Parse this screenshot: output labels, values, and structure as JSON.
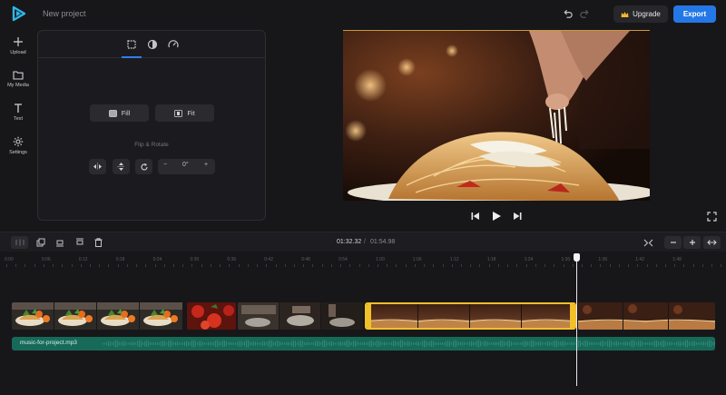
{
  "header": {
    "project_title": "New project",
    "upgrade_label": "Upgrade",
    "export_label": "Export",
    "accent_color": "#2478e6"
  },
  "nav": {
    "items": [
      {
        "label": "Upload",
        "icon": "plus-icon"
      },
      {
        "label": "My Media",
        "icon": "folder-icon"
      },
      {
        "label": "Text",
        "icon": "text-icon"
      },
      {
        "label": "Settings",
        "icon": "gear-icon"
      }
    ]
  },
  "panel": {
    "tabs": [
      "crop-icon",
      "contrast-icon",
      "speed-icon"
    ],
    "fill_label": "Fill",
    "fit_label": "Fit",
    "flip_rotate_label": "Flip & Rotate",
    "rotation_value": "0°",
    "minus_label": "−",
    "plus_label": "+"
  },
  "timeline": {
    "current_time": "01:32.32",
    "separator": "/",
    "total_time": "01:54.98",
    "ruler_labels": [
      "0:00",
      "0:06",
      "0:12",
      "0:18",
      "0:24",
      "0:30",
      "0:36",
      "0:42",
      "0:48",
      "0:54",
      "1:00",
      "1:06",
      "1:12",
      "1:18",
      "1:24",
      "1:30",
      "1:36",
      "1:42",
      "1:48"
    ],
    "audio_label": "music-for-project.mp3",
    "audio_color": "#186a58",
    "selected_clip_color": "#f2c029",
    "playhead_time": "01:32.32"
  }
}
